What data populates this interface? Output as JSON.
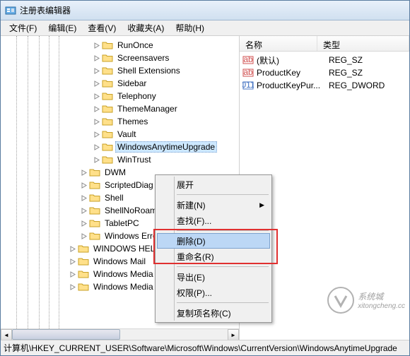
{
  "window": {
    "title": "注册表编辑器"
  },
  "menu": {
    "file": "文件(F)",
    "edit": "编辑(E)",
    "view": "查看(V)",
    "favorites": "收藏夹(A)",
    "help": "帮助(H)"
  },
  "tree": {
    "group1_indent": 130,
    "group1": [
      {
        "label": "RunOnce"
      },
      {
        "label": "Screensavers"
      },
      {
        "label": "Shell Extensions"
      },
      {
        "label": "Sidebar"
      },
      {
        "label": "Telephony"
      },
      {
        "label": "ThemeManager"
      },
      {
        "label": "Themes"
      },
      {
        "label": "Vault"
      }
    ],
    "selected": {
      "label": "WindowsAnytimeUpgrade",
      "display": "WindowsAnytimeUpgrade"
    },
    "group1b": [
      {
        "label": "WinTrust"
      }
    ],
    "group2_indent": 112,
    "group2": [
      {
        "label": "DWM"
      },
      {
        "label": "ScriptedDiag"
      },
      {
        "label": "Shell"
      },
      {
        "label": "ShellNoRoam"
      },
      {
        "label": "TabletPC"
      },
      {
        "label": "Windows Erro"
      }
    ],
    "group3_indent": 96,
    "group3": [
      {
        "label": "WINDOWS HELP"
      },
      {
        "label": "Windows Mail"
      },
      {
        "label": "Windows Media"
      },
      {
        "label": "Windows Media Foundation"
      }
    ]
  },
  "list": {
    "col_name": "名称",
    "col_type": "类型",
    "rows": [
      {
        "icon": "str",
        "name": "(默认)",
        "type": "REG_SZ"
      },
      {
        "icon": "str",
        "name": "ProductKey",
        "type": "REG_SZ"
      },
      {
        "icon": "bin",
        "name": "ProductKeyPur...",
        "type": "REG_DWORD"
      }
    ]
  },
  "ctxmenu": {
    "expand": "展开",
    "new": "新建(N)",
    "find": "查找(F)...",
    "delete": "删除(D)",
    "rename": "重命名(R)",
    "export": "导出(E)",
    "permissions": "权限(P)...",
    "copykey": "复制项名称(C)"
  },
  "statusbar": {
    "path": "计算机\\HKEY_CURRENT_USER\\Software\\Microsoft\\Windows\\CurrentVersion\\WindowsAnytimeUpgrade"
  },
  "watermark": {
    "main": "系统城",
    "sub": "xitongcheng.cc"
  }
}
